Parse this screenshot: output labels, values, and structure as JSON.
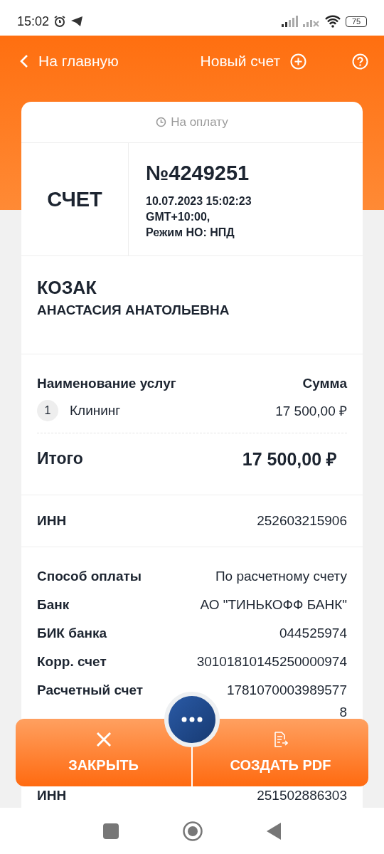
{
  "status_bar": {
    "time": "15:02",
    "battery": "75"
  },
  "header": {
    "back": "На главную",
    "new_invoice": "Новый счет"
  },
  "invoice": {
    "status": "На оплату",
    "type": "СЧЕТ",
    "number": "№4249251",
    "details": [
      "10.07.2023 15:02:23",
      "GMT+10:00,",
      "Режим НО: НПД"
    ]
  },
  "client": {
    "surname": "КОЗАК",
    "name": "АНАСТАСИЯ АНАТОЛЬЕВНА"
  },
  "services": {
    "columns": [
      "Наименование услуг",
      "Сумма"
    ],
    "items": [
      {
        "index": "1",
        "name": "Клининг",
        "amount": "17 500,00 ₽"
      }
    ],
    "total_label": "Итого",
    "total": "17 500,00 ₽"
  },
  "inn": {
    "label": "ИНН",
    "value": "252603215906"
  },
  "payment": [
    {
      "label": "Способ оплаты",
      "value": "По расчетному счету"
    },
    {
      "label": "Банк",
      "value": "АО \"ТИНЬКОФФ БАНК\""
    },
    {
      "label": "БИК банка",
      "value": "044525974"
    },
    {
      "label": "Корр. счет",
      "value": "30101810145250000974"
    },
    {
      "label": "Расчетный счет",
      "value": "1781070003989577",
      "continuation": "8"
    },
    {
      "label": "ИНН",
      "value": "251502886303"
    }
  ],
  "actions": [
    {
      "kind": "close",
      "label": "ЗАКРЫТЬ"
    },
    {
      "kind": "pdf",
      "label": "СОЗДАТЬ PDF"
    }
  ]
}
